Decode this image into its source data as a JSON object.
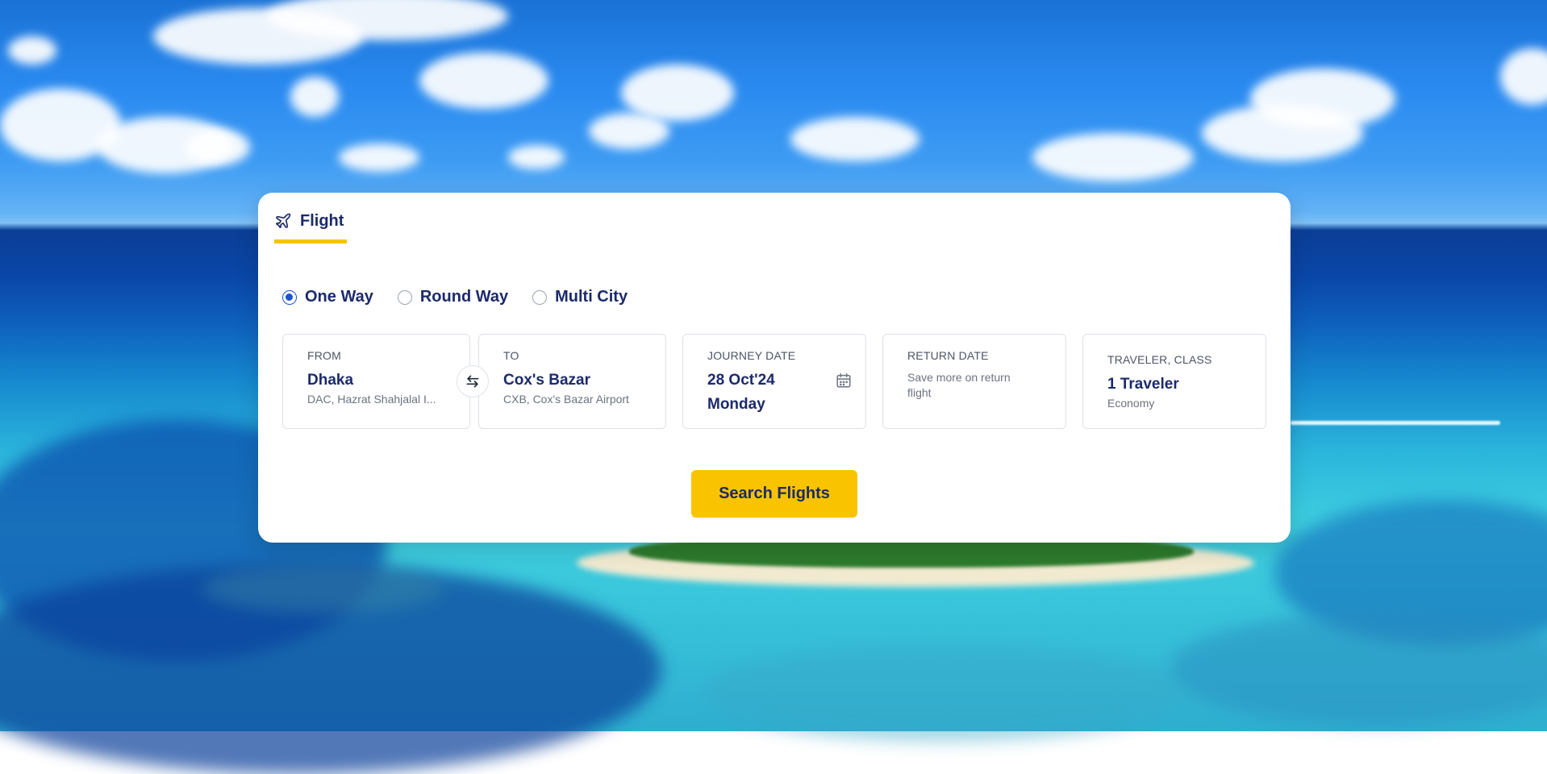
{
  "colors": {
    "accent": "#f9c300",
    "primary_text": "#1b2a6b",
    "radio_selected": "#1a56c8"
  },
  "tabs": [
    {
      "label": "Flight",
      "icon": "airplane-icon",
      "active": true
    }
  ],
  "trip_types": [
    {
      "label": "One Way",
      "selected": true
    },
    {
      "label": "Round Way",
      "selected": false
    },
    {
      "label": "Multi City",
      "selected": false
    }
  ],
  "fields": {
    "from": {
      "label": "FROM",
      "value": "Dhaka",
      "sub": "DAC, Hazrat Shahjalal I..."
    },
    "to": {
      "label": "TO",
      "value": "Cox's Bazar",
      "sub": "CXB, Cox's Bazar Airport"
    },
    "journey_date": {
      "label": "JOURNEY DATE",
      "date": "28 Oct'24",
      "day": "Monday"
    },
    "return_date": {
      "label": "RETURN DATE",
      "note": "Save more on return flight"
    },
    "traveler_class": {
      "label": "TRAVELER, CLASS",
      "value": "1 Traveler",
      "sub": "Economy"
    }
  },
  "search_button": {
    "label": "Search Flights"
  }
}
